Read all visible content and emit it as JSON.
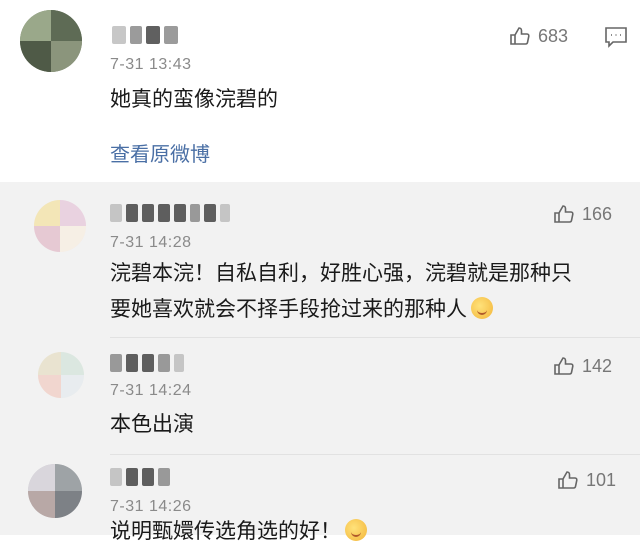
{
  "main_comment": {
    "time": "7-31 13:43",
    "likes": "683",
    "text": "她真的蛮像浣碧的",
    "view_original_label": "查看原微博"
  },
  "replies": [
    {
      "time": "7-31 14:28",
      "likes": "166",
      "text_line1": "浣碧本浣！自私自利，好胜心强，浣碧就是那种只",
      "text_line2": "要她喜欢就会不择手段抢过来的那种人"
    },
    {
      "time": "7-31 14:24",
      "likes": "142",
      "text_line1": "本色出演"
    },
    {
      "time": "7-31 14:26",
      "likes": "101",
      "text_line1": "说明甄嬛传选角选的好！"
    }
  ],
  "icons": {
    "like": "thumbs-up-icon",
    "comment": "comment-icon",
    "emoji": "emoji-icon"
  }
}
